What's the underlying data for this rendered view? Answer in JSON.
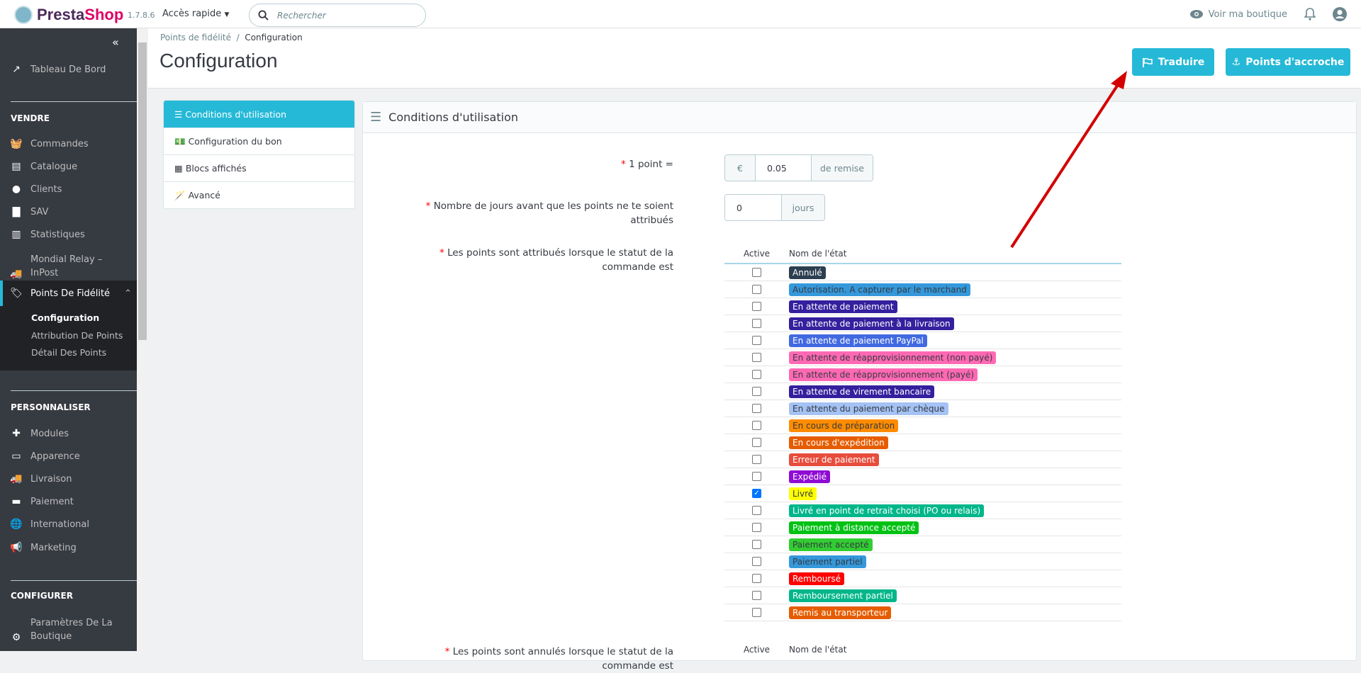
{
  "header": {
    "logo": "PrestaShop",
    "version": "1.7.8.6",
    "quick_access": "Accès rapide",
    "search_placeholder": "Rechercher",
    "view_shop": "Voir ma boutique"
  },
  "sidebar": {
    "dashboard": "Tableau De Bord",
    "sections": [
      {
        "title": "VENDRE",
        "items": [
          "Commandes",
          "Catalogue",
          "Clients",
          "SAV",
          "Statistiques",
          "Mondial Relay – InPost",
          "Points De Fidélité"
        ]
      },
      {
        "title": "PERSONNALISER",
        "items": [
          "Modules",
          "Apparence",
          "Livraison",
          "Paiement",
          "International",
          "Marketing"
        ]
      },
      {
        "title": "CONFIGURER",
        "items": [
          "Paramètres De La Boutique"
        ]
      }
    ],
    "submenu": [
      "Configuration",
      "Attribution De Points",
      "Détail Des Points"
    ]
  },
  "breadcrumb": {
    "parent": "Points de fidélité",
    "separator": "/",
    "current": "Configuration"
  },
  "page_title": "Configuration",
  "toolbar": {
    "translate": "Traduire",
    "hooks": "Points d'accroche"
  },
  "tabs": [
    "Conditions d'utilisation",
    "Configuration du bon",
    "Blocs affichés",
    "Avancé"
  ],
  "panel": {
    "title": "Conditions d'utilisation",
    "point_label": "1 point =",
    "point_currency": "€",
    "point_value": "0.05",
    "point_suffix": "de remise",
    "days_label": "Nombre de jours avant que les points ne te soient attribués",
    "days_value": "0",
    "days_suffix": "jours",
    "status_label": "Les points sont attribués lorsque le statut de la commande est",
    "cancel_label": "Les points sont annulés lorsque le statut de la commande est",
    "col_active": "Active",
    "col_name": "Nom de l'état"
  },
  "states": [
    {
      "name": "Annulé",
      "color": "#2c3e50",
      "text": "#fff",
      "checked": false
    },
    {
      "name": "Autorisation. A capturer par le marchand",
      "color": "#3498db",
      "text": "#363a41",
      "checked": false
    },
    {
      "name": "En attente de paiement",
      "color": "#34209e",
      "text": "#fff",
      "checked": false
    },
    {
      "name": "En attente de paiement à la livraison",
      "color": "#34209e",
      "text": "#fff",
      "checked": false
    },
    {
      "name": "En attente de paiement PayPal",
      "color": "#4169e1",
      "text": "#fff",
      "checked": false
    },
    {
      "name": "En attente de réapprovisionnement (non payé)",
      "color": "#ff69b4",
      "text": "#363a41",
      "checked": false
    },
    {
      "name": "En attente de réapprovisionnement (payé)",
      "color": "#ff69b4",
      "text": "#363a41",
      "checked": false
    },
    {
      "name": "En attente de virement bancaire",
      "color": "#34209e",
      "text": "#fff",
      "checked": false
    },
    {
      "name": "En attente du paiement par chèque",
      "color": "#a4c2f4",
      "text": "#363a41",
      "checked": false
    },
    {
      "name": "En cours de préparation",
      "color": "#ff8c00",
      "text": "#363a41",
      "checked": false
    },
    {
      "name": "En cours d'expédition",
      "color": "#e65c00",
      "text": "#fff",
      "checked": false
    },
    {
      "name": "Erreur de paiement",
      "color": "#e74c3c",
      "text": "#fff",
      "checked": false
    },
    {
      "name": "Expédié",
      "color": "#8f0cd4",
      "text": "#fff",
      "checked": false
    },
    {
      "name": "Livré",
      "color": "#ffff00",
      "text": "#363a41",
      "checked": true
    },
    {
      "name": "Livré en point de retrait choisi (PO ou relais)",
      "color": "#00b68a",
      "text": "#fff",
      "checked": false
    },
    {
      "name": "Paiement à distance accepté",
      "color": "#00c214",
      "text": "#fff",
      "checked": false
    },
    {
      "name": "Paiement accepté",
      "color": "#32cd32",
      "text": "#363a41",
      "checked": false
    },
    {
      "name": "Paiement partiel",
      "color": "#3498db",
      "text": "#363a41",
      "checked": false
    },
    {
      "name": "Remboursé",
      "color": "#ff0000",
      "text": "#fff",
      "checked": false
    },
    {
      "name": "Remboursement partiel",
      "color": "#00b68a",
      "text": "#fff",
      "checked": false
    },
    {
      "name": "Remis au transporteur",
      "color": "#e65c00",
      "text": "#fff",
      "checked": false
    }
  ]
}
